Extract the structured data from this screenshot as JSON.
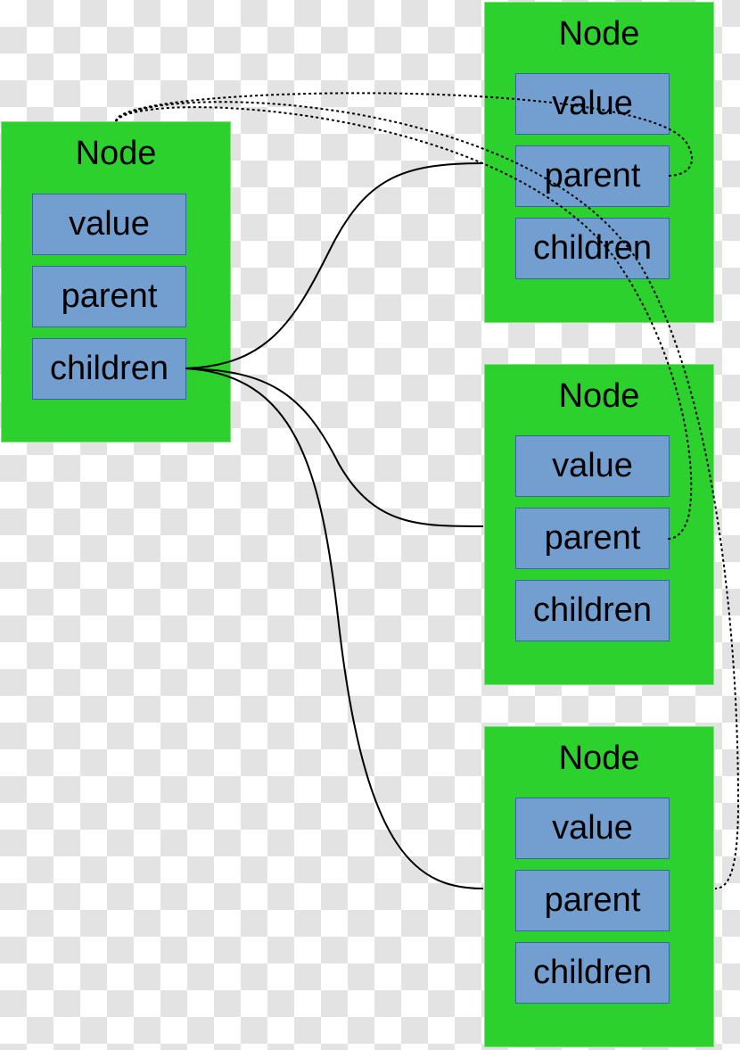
{
  "colors": {
    "node": "#2dd12d",
    "field": "#729fcf",
    "field_border": "#3465a4"
  },
  "nodes": [
    {
      "title": "Node",
      "fields": [
        "value",
        "parent",
        "children"
      ]
    },
    {
      "title": "Node",
      "fields": [
        "value",
        "parent",
        "children"
      ]
    },
    {
      "title": "Node",
      "fields": [
        "value",
        "parent",
        "children"
      ]
    },
    {
      "title": "Node",
      "fields": [
        "value",
        "parent",
        "children"
      ]
    }
  ],
  "edges": {
    "children_links": "solid: root children to each child node",
    "parent_links": "dotted: each child parent to root node"
  }
}
